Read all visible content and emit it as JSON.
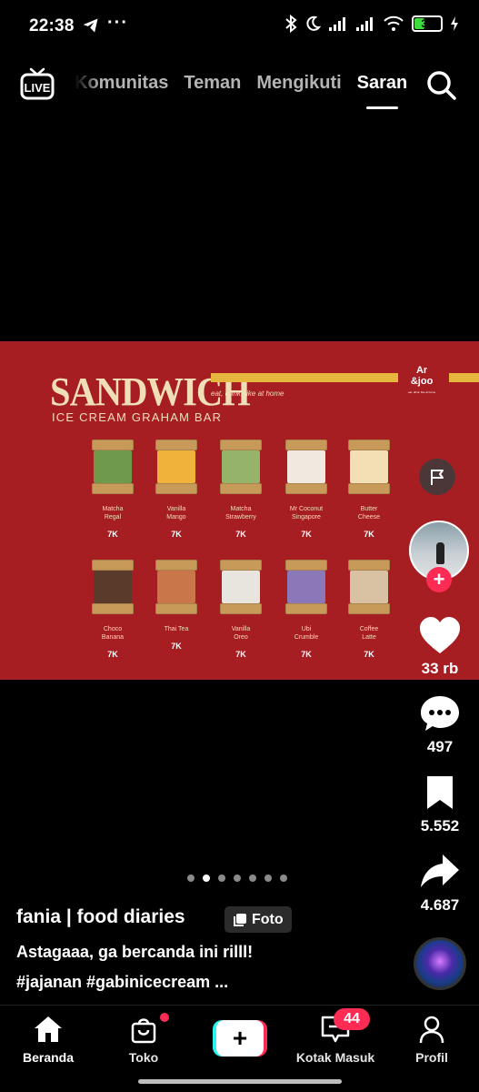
{
  "status_bar": {
    "time": "22:38",
    "more": "···",
    "battery": "37",
    "icons": [
      "telegram-icon",
      "bluetooth-icon",
      "moon-icon",
      "signal-icon",
      "signal-icon",
      "wifi-icon",
      "battery-icon",
      "charging-icon"
    ]
  },
  "top_nav": {
    "live_label": "LIVE",
    "tabs": [
      "Komunitas",
      "Teman",
      "Mengikuti",
      "Saran"
    ],
    "active_tab": "Saran"
  },
  "post_image": {
    "title": "SANDWICH",
    "subtitle": "ICE CREAM GRAHAM BAR",
    "tagline": "eat, drink, like at home",
    "brand_line1": "Ar",
    "brand_line2": "&joo",
    "brand_small": "eat, drink, like at home",
    "accent_color": "#e6b63e",
    "background_color": "#a61e22",
    "items_row1": [
      {
        "name1": "Matcha",
        "name2": "Regal",
        "price": "7K",
        "cream": "#6f9a4b"
      },
      {
        "name1": "Vanilla",
        "name2": "Mango",
        "price": "7K",
        "cream": "#f0b23a"
      },
      {
        "name1": "Matcha",
        "name2": "Strawberry",
        "price": "7K",
        "cream": "#96b36a"
      },
      {
        "name1": "Mr Coconut",
        "name2": "Singapore",
        "price": "7K",
        "cream": "#efe9df"
      },
      {
        "name1": "Butter",
        "name2": "Cheese",
        "price": "7K",
        "cream": "#f3dfb4"
      }
    ],
    "items_row2": [
      {
        "name1": "Choco",
        "name2": "Banana",
        "price": "7K",
        "cream": "#5a3a2a"
      },
      {
        "name1": "Thai Tea",
        "name2": "",
        "price": "7K",
        "cream": "#c9774a"
      },
      {
        "name1": "Vanilla",
        "name2": "Oreo",
        "price": "7K",
        "cream": "#e8e4de"
      },
      {
        "name1": "Ubi",
        "name2": "Crumble",
        "price": "7K",
        "cream": "#8a78b8"
      },
      {
        "name1": "Coffee",
        "name2": "Latte",
        "price": "7K",
        "cream": "#d8c2a3"
      }
    ]
  },
  "right_rail": {
    "likes": "33 rb",
    "comments": "497",
    "saves": "5.552",
    "shares": "4.687"
  },
  "carousel": {
    "count": 7,
    "active_index": 1
  },
  "caption": {
    "author": "fania | food diaries",
    "badge": "Foto",
    "text": "Astagaaa, ga bercanda ini rilll!",
    "hashtags": "#jajanan #gabinicecream ..."
  },
  "bottom_nav": {
    "home": "Beranda",
    "shop": "Toko",
    "inbox": "Kotak Masuk",
    "inbox_badge": "44",
    "profile": "Profil"
  }
}
